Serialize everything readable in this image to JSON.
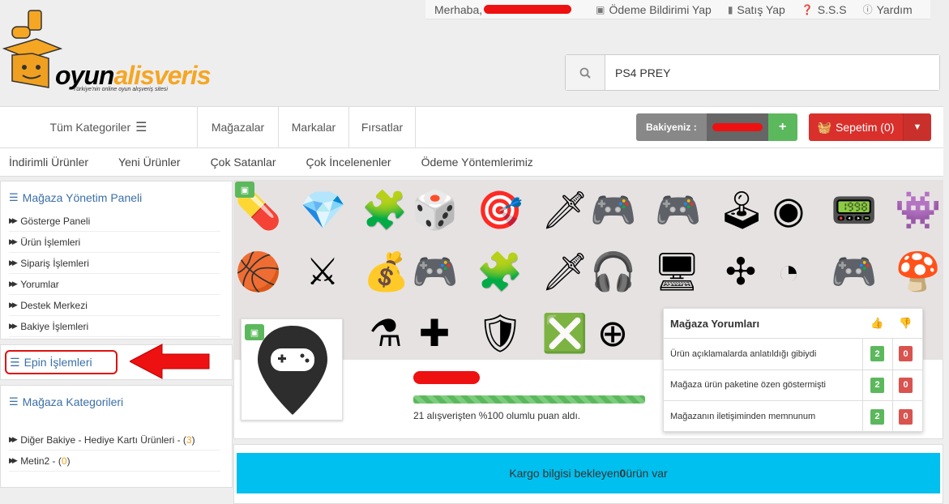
{
  "topbar": {
    "greeting": "Merhaba,",
    "payment_notice": "Ödeme Bildirimi Yap",
    "sell": "Satış Yap",
    "faq": "S.S.S",
    "help": "Yardım"
  },
  "logo": {
    "word_main": "oyun",
    "word_accent": "alisveris",
    "tagline": "Türkiye'nin online oyun alışveriş sitesi"
  },
  "search": {
    "value": "PS4 PREY"
  },
  "nav": {
    "all_categories": "Tüm Kategoriler",
    "links": [
      "Mağazalar",
      "Markalar",
      "Fırsatlar"
    ],
    "balance_label": "Bakiyeniz :",
    "add_label": "+",
    "cart_label": "Sepetim (0)"
  },
  "subnav": [
    "İndirimli Ürünler",
    "Yeni Ürünler",
    "Çok Satanlar",
    "Çok İncelenenler",
    "Ödeme Yöntemlerimiz"
  ],
  "sidebar": {
    "panel_title": "Mağaza Yönetim Paneli",
    "items": [
      "Gösterge Paneli",
      "Ürün İşlemleri",
      "Sipariş İşlemleri",
      "Yorumlar",
      "Destek Merkezi",
      "Bakiye İşlemleri"
    ],
    "epin": "Epin İşlemleri",
    "categories_title": "Mağaza Kategorileri",
    "categories": [
      {
        "name": "Diğer Bakiye - Hediye Kartı Ürünleri - (",
        "count": "3",
        "close": ")"
      },
      {
        "name": "Metin2 - (",
        "count": "0",
        "close": ")"
      }
    ]
  },
  "profile": {
    "progress_percent": 100,
    "rating_text": "21 alışverişten %100 olumlu puan aldı."
  },
  "reviews": {
    "title": "Mağaza Yorumları",
    "rows": [
      {
        "text": "Ürün açıklamalarda anlatıldığı gibiydi",
        "up": "2",
        "down": "0"
      },
      {
        "text": "Mağaza ürün paketine özen göstermişti",
        "up": "2",
        "down": "0"
      },
      {
        "text": "Mağazanın iletişiminden memnunum",
        "up": "2",
        "down": "0"
      }
    ]
  },
  "kargo": {
    "before": "Kargo bilgisi bekleyen ",
    "count": "0",
    "after": " ürün var"
  },
  "colors": {
    "accent_blue": "#3a6fa8",
    "success": "#5cb85c",
    "danger": "#d9302c",
    "info": "#00c0ef",
    "highlight": "#ee1111"
  },
  "icons": [
    "pill-icon",
    "diamond-icon",
    "puzzle-icon",
    "dice-icon",
    "target-icon",
    "sword-icon",
    "gamepad-icon",
    "joystick-icon",
    "pokeball-icon",
    "space-invader-icon",
    "basketball-icon",
    "money-bag-icon",
    "headset-icon",
    "computer-icon",
    "pacman-icon",
    "mushroom-icon",
    "potion-icon",
    "dpad-icon",
    "shield-icon",
    "close-icon",
    "plus-icon"
  ]
}
